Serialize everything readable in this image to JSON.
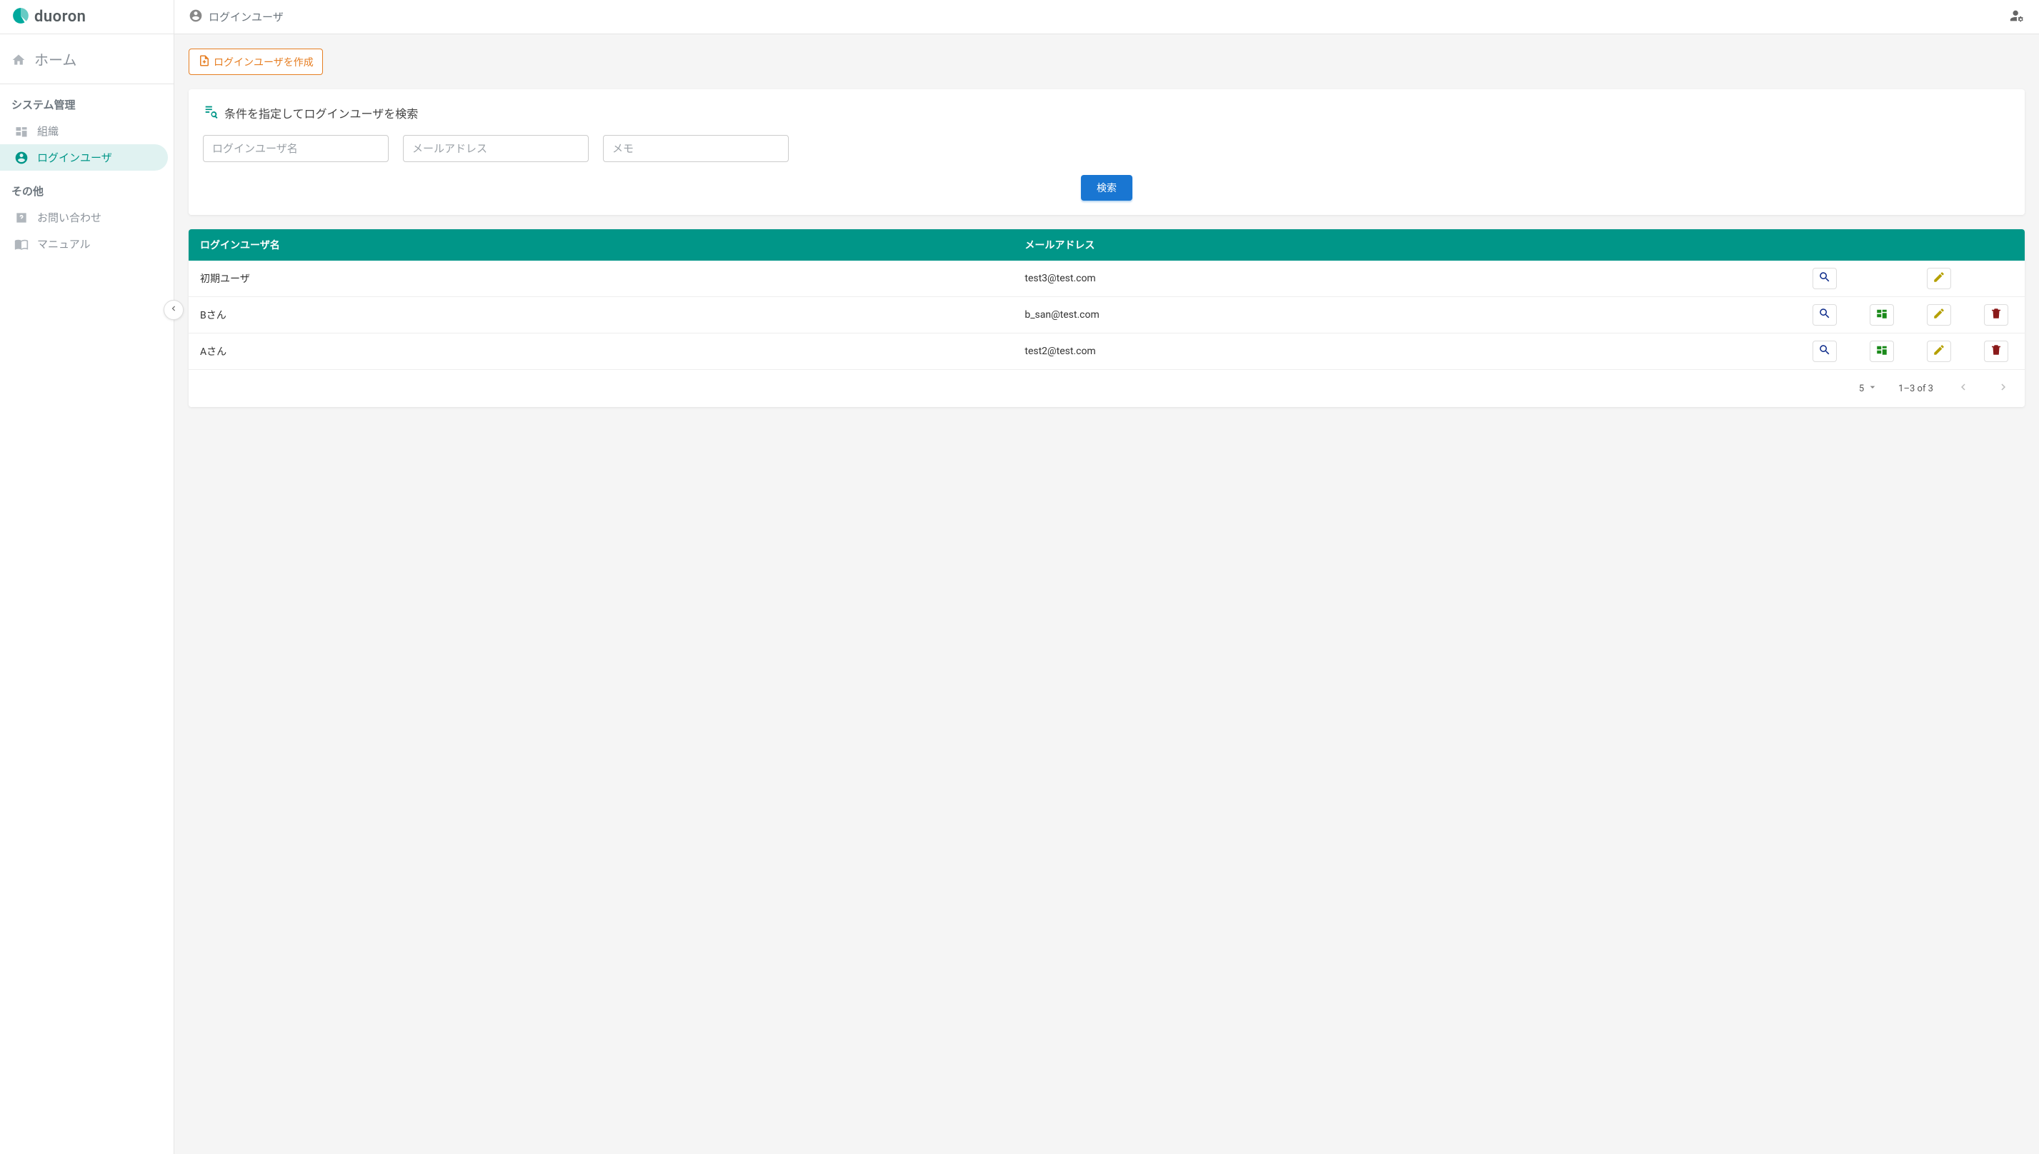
{
  "brand": {
    "name": "duoron"
  },
  "topbar": {
    "title": "ログインユーザ"
  },
  "sidebar": {
    "home_label": "ホーム",
    "sections": [
      {
        "title": "システム管理",
        "items": [
          {
            "label": "組織",
            "icon": "org"
          },
          {
            "label": "ログインユーザ",
            "icon": "user",
            "active": true
          }
        ]
      },
      {
        "title": "その他",
        "items": [
          {
            "label": "お問い合わせ",
            "icon": "help"
          },
          {
            "label": "マニュアル",
            "icon": "book"
          }
        ]
      }
    ]
  },
  "buttons": {
    "create_user": "ログインユーザを作成",
    "search": "検索"
  },
  "search": {
    "title": "条件を指定してログインユーザを検索",
    "placeholder_name": "ログインユーザ名",
    "placeholder_email": "メールアドレス",
    "placeholder_memo": "メモ"
  },
  "table": {
    "headers": {
      "name": "ログインユーザ名",
      "email": "メールアドレス"
    },
    "rows": [
      {
        "name": "初期ユーザ",
        "email": "test3@test.com",
        "has_org": false,
        "has_delete": false
      },
      {
        "name": "Bさん",
        "email": "b_san@test.com",
        "has_org": true,
        "has_delete": true
      },
      {
        "name": "Aさん",
        "email": "test2@test.com",
        "has_org": true,
        "has_delete": true
      }
    ]
  },
  "pagination": {
    "page_size": "5",
    "range": "1–3 of 3"
  }
}
